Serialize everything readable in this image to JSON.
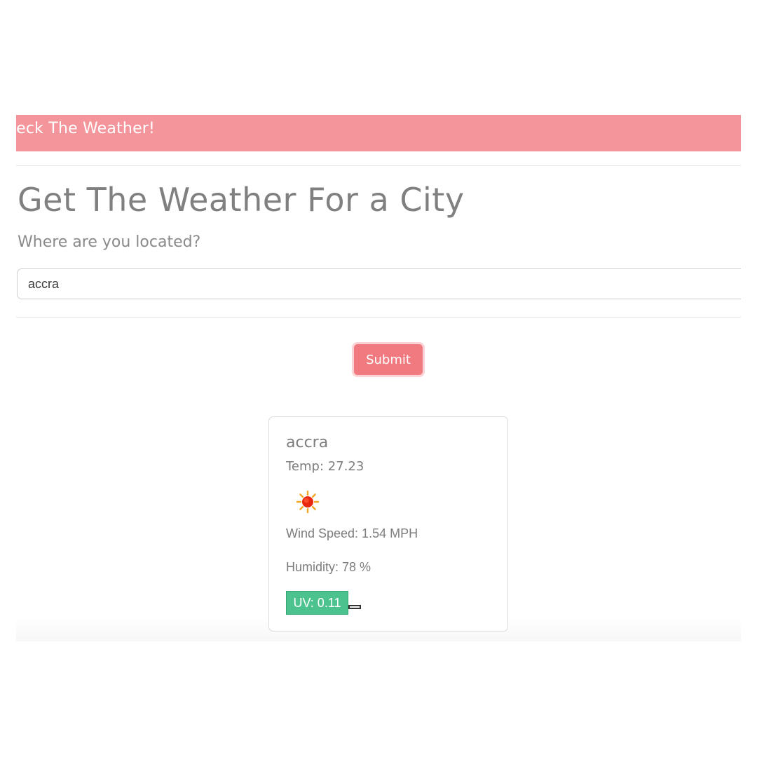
{
  "header": {
    "banner_text": "heck The Weather!",
    "banner_color": "#f4959b"
  },
  "search": {
    "title": "Get The Weather For a City",
    "prompt": "Where are you located?",
    "input_value": "accra",
    "submit_label": "Submit",
    "submit_color": "#f07a80"
  },
  "result": {
    "city": "accra",
    "temp_text": "Temp: 27.23",
    "icon": "sun-icon",
    "wind_text": "Wind Speed: 1.54 MPH",
    "humidity_text": "Humidity: 78 %",
    "uv_text": "UV: 0.11",
    "uv_color": "#4cc38f"
  }
}
